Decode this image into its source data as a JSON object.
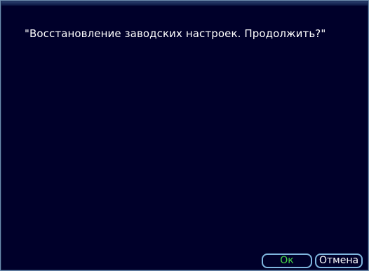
{
  "dialog": {
    "message": "\"Восстановление заводских настроек. Продолжить?\"",
    "ok_label": "Ок",
    "cancel_label": "Отмена"
  },
  "colors": {
    "background": "#00002a",
    "border": "#6f8fb0",
    "button_border": "#7fb6df",
    "ok_text": "#48d848",
    "text": "#ffffff"
  }
}
